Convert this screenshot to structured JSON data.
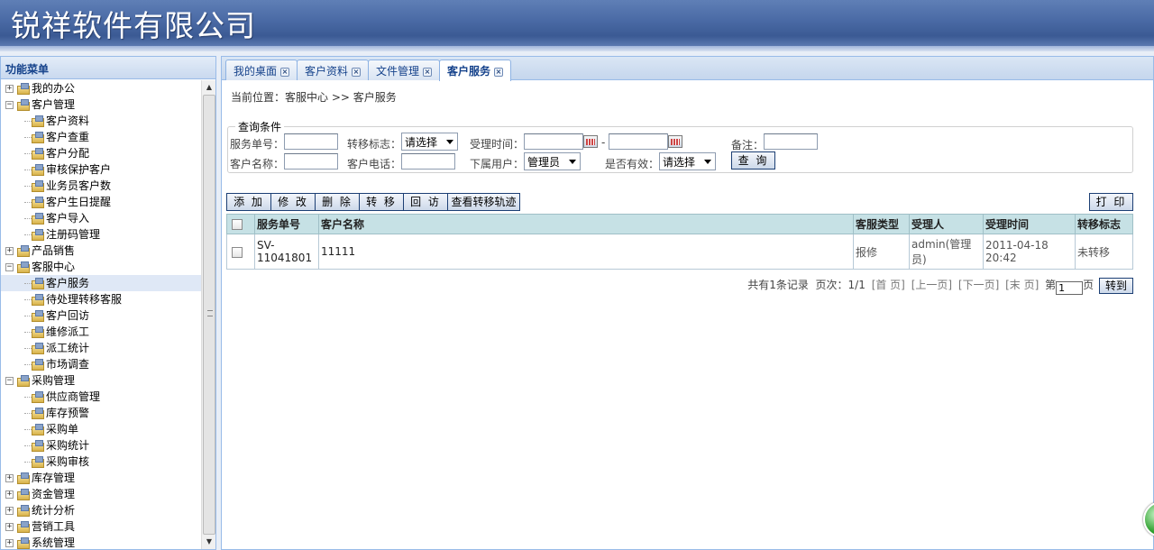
{
  "header": {
    "title": "锐祥软件有限公司"
  },
  "sidebar": {
    "title": "功能菜单",
    "groups": [
      {
        "label": "我的办公",
        "expanded": false,
        "items": []
      },
      {
        "label": "客户管理",
        "expanded": true,
        "items": [
          "客户资料",
          "客户查重",
          "客户分配",
          "审核保护客户",
          "业务员客户数",
          "客户生日提醒",
          "客户导入",
          "注册码管理"
        ]
      },
      {
        "label": "产品销售",
        "expanded": false,
        "items": []
      },
      {
        "label": "客服中心",
        "expanded": true,
        "items": [
          "客户服务",
          "待处理转移客服",
          "客户回访",
          "维修派工",
          "派工统计",
          "市场调查"
        ]
      },
      {
        "label": "采购管理",
        "expanded": true,
        "items": [
          "供应商管理",
          "库存预警",
          "采购单",
          "采购统计",
          "采购审核"
        ]
      },
      {
        "label": "库存管理",
        "expanded": false,
        "items": []
      },
      {
        "label": "资金管理",
        "expanded": false,
        "items": []
      },
      {
        "label": "统计分析",
        "expanded": false,
        "items": []
      },
      {
        "label": "营销工具",
        "expanded": false,
        "items": []
      },
      {
        "label": "系统管理",
        "expanded": false,
        "items": []
      }
    ],
    "selected": "客户服务"
  },
  "tabs": [
    {
      "label": "我的桌面",
      "active": false
    },
    {
      "label": "客户资料",
      "active": false
    },
    {
      "label": "文件管理",
      "active": false
    },
    {
      "label": "客户服务",
      "active": true
    }
  ],
  "breadcrumb": "当前位置：客服中心 >> 客户服务",
  "query": {
    "legend": "查询条件",
    "service_no_label": "服务单号：",
    "transfer_flag_label": "转移标志：",
    "transfer_flag_value": "请选择",
    "accept_time_label": "受理时间：",
    "date_sep": "-",
    "remark_label": "备注：",
    "customer_name_label": "客户名称：",
    "customer_phone_label": "客户电话：",
    "sub_user_label": "下属用户：",
    "sub_user_value": "管理员",
    "valid_label": "是否有效：",
    "valid_value": "请选择",
    "search_button": "查 询"
  },
  "toolbar": {
    "add": "添 加",
    "edit": "修 改",
    "delete": "删 除",
    "transfer": "转 移",
    "revisit": "回 访",
    "track": "查看转移轨迹",
    "print": "打 印"
  },
  "grid": {
    "columns": [
      "服务单号",
      "客户名称",
      "客服类型",
      "受理人",
      "受理时间",
      "转移标志"
    ],
    "rows": [
      {
        "service_no": "SV-11041801",
        "customer_name": "11111",
        "service_type": "报修",
        "handler": "admin(管理员)",
        "accept_time": "2011-04-18 20:42",
        "transfer_flag": "未转移"
      }
    ]
  },
  "pager": {
    "summary": "共有1条记录  页次：1/1",
    "first": "[首 页]",
    "prev": "[上一页]",
    "next": "[下一页]",
    "last": "[末 页]",
    "page_prefix": "第",
    "page_value": "1",
    "page_suffix": "页",
    "go": "转到"
  }
}
